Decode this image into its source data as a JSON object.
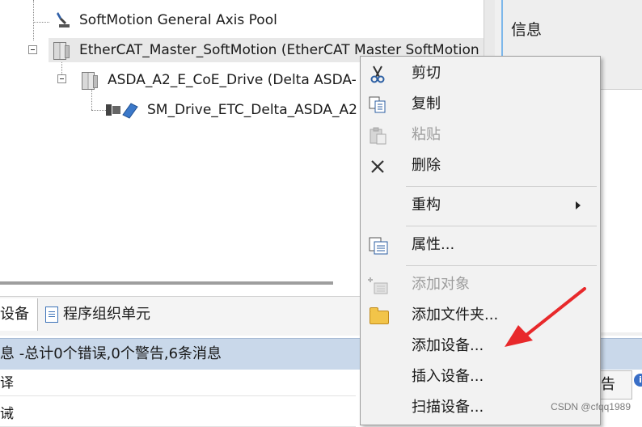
{
  "tree": {
    "items": [
      {
        "label": "SoftMotion General Axis Pool",
        "icon": "axis-pool-icon"
      },
      {
        "label": "EtherCAT_Master_SoftMotion (EtherCAT Master SoftMotion",
        "icon": "ethercat-master-icon"
      },
      {
        "label": "ASDA_A2_E_CoE_Drive (Delta ASDA-",
        "icon": "drive-device-icon"
      },
      {
        "label": "SM_Drive_ETC_Delta_ASDA_A2",
        "icon": "softmotion-drive-icon"
      }
    ]
  },
  "info_panel": {
    "title": "信息"
  },
  "bottom_tabs": [
    {
      "label": "设备",
      "icon": "devices-icon"
    },
    {
      "label": "程序组织单元",
      "icon": "pou-icon"
    }
  ],
  "messages": {
    "summary": "息 -总计0个错误,0个警告,6条消息",
    "rows": [
      "译",
      "诫"
    ],
    "warning_tab": "告",
    "info_badge": "i"
  },
  "context_menu": {
    "items": [
      {
        "label": "剪切",
        "icon": "scissors-icon",
        "enabled": true
      },
      {
        "label": "复制",
        "icon": "copy-icon",
        "enabled": true
      },
      {
        "label": "粘贴",
        "icon": "paste-icon",
        "enabled": false
      },
      {
        "label": "删除",
        "icon": "delete-icon",
        "enabled": true
      },
      {
        "label": "重构",
        "icon": "",
        "enabled": true,
        "submenu": true
      },
      {
        "label": "属性...",
        "icon": "properties-icon",
        "enabled": true
      },
      {
        "label": "添加对象",
        "icon": "add-object-icon",
        "enabled": false
      },
      {
        "label": "添加文件夹...",
        "icon": "folder-icon",
        "enabled": true
      },
      {
        "label": "添加设备...",
        "icon": "",
        "enabled": true
      },
      {
        "label": "插入设备...",
        "icon": "",
        "enabled": true
      },
      {
        "label": "扫描设备...",
        "icon": "",
        "enabled": true
      }
    ]
  },
  "annotation": {
    "arrow_color": "#e8292b",
    "target": "添加设备..."
  },
  "watermark": "CSDN @cfqq1989",
  "colors": {
    "selection": "#e8e8e8",
    "message_bar": "#c9d8ea",
    "accent": "#3a6fc7"
  }
}
